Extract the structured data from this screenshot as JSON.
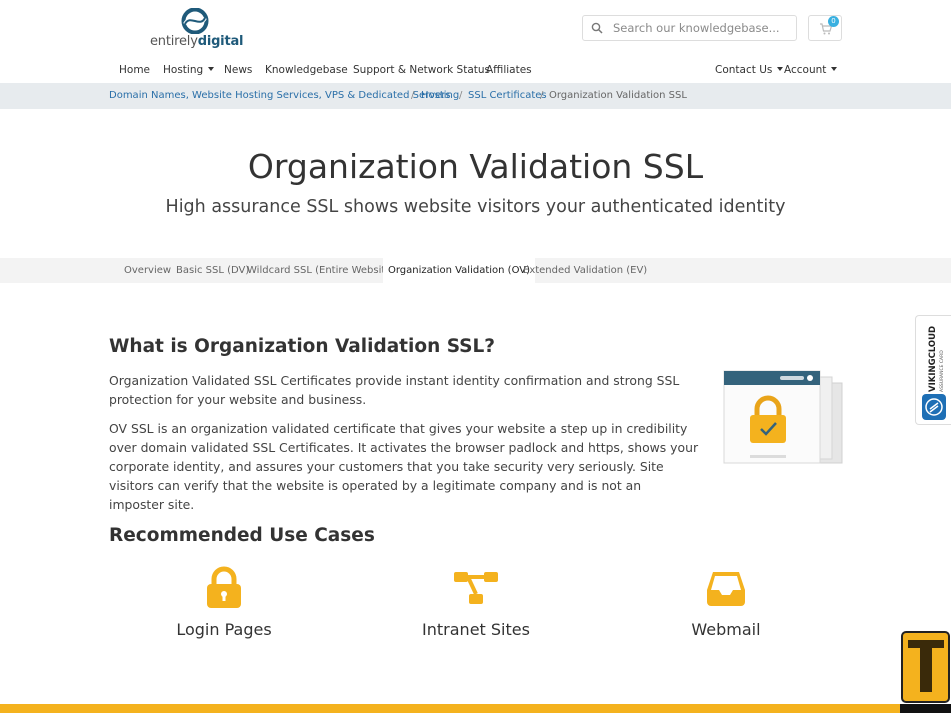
{
  "brand": {
    "logo_part1": "entirely",
    "logo_part2": "digital",
    "accent": "#1f5a7a",
    "icon_yellow": "#f4b21e"
  },
  "header": {
    "search_placeholder": "Search our knowledgebase...",
    "cart_count": "0"
  },
  "nav": {
    "home": "Home",
    "hosting": "Hosting",
    "news": "News",
    "knowledgebase": "Knowledgebase",
    "support": "Support & Network Status",
    "affiliates": "Affiliates",
    "contact": "Contact Us",
    "account": "Account"
  },
  "breadcrumb": {
    "items": [
      "Domain Names, Website Hosting Services, VPS & Dedicated Servers",
      "Hosting",
      "SSL Certificates",
      "Organization Validation SSL"
    ],
    "separator": "/"
  },
  "hero": {
    "title": "Organization Validation SSL",
    "subtitle": "High assurance SSL shows website visitors your authenticated identity"
  },
  "tabs": [
    "Overview",
    "Basic SSL (DV)",
    "Wildcard SSL (Entire Website)",
    "Organization Validation (OV)",
    "Extended Validation (EV)"
  ],
  "section": {
    "heading": "What is Organization Validation SSL?",
    "para1": "Organization Validated SSL Certificates provide instant identity confirmation and strong SSL protection for your website and business.",
    "para2": "OV SSL is an organization validated certificate that gives your website a step up in credibility over domain validated SSL Certificates. It activates the browser padlock and https, shows your corporate identity, and assures your customers that you take security very seriously. Site visitors can verify that the website is operated by a legitimate company and is not an imposter site."
  },
  "use_cases": {
    "heading": "Recommended Use Cases",
    "items": [
      {
        "label": "Login Pages",
        "icon": "lock-icon"
      },
      {
        "label": "Intranet Sites",
        "icon": "sitemap-icon"
      },
      {
        "label": "Webmail",
        "icon": "inbox-icon"
      }
    ]
  },
  "side_badge": {
    "line1": "VIKINGCLOUD",
    "line2": "ASSURANCE CARD"
  }
}
